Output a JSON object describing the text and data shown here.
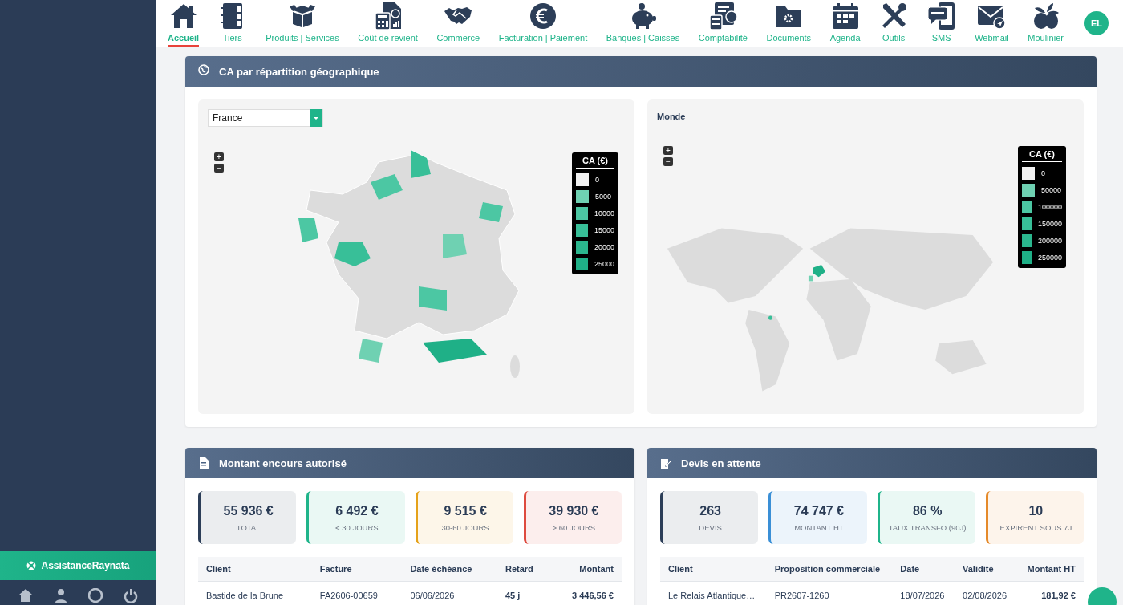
{
  "sidebar": {
    "support_button": "AssistanceRaynata"
  },
  "nav": {
    "items": [
      {
        "label": "Accueil",
        "selected": true
      },
      {
        "label": "Tiers",
        "selected": false
      },
      {
        "label": "Produits | Services",
        "selected": false
      },
      {
        "label": "Coût de revient",
        "selected": false
      },
      {
        "label": "Commerce",
        "selected": false
      },
      {
        "label": "Facturation | Paiement",
        "selected": false
      },
      {
        "label": "Banques | Caisses",
        "selected": false
      },
      {
        "label": "Comptabilité",
        "selected": false
      },
      {
        "label": "Documents",
        "selected": false
      },
      {
        "label": "Agenda",
        "selected": false
      },
      {
        "label": "Outils",
        "selected": false
      },
      {
        "label": "SMS",
        "selected": false
      },
      {
        "label": "Webmail",
        "selected": false
      },
      {
        "label": "Moulinier",
        "selected": false
      }
    ],
    "avatar": "EL"
  },
  "geo_panel": {
    "title": "CA par répartition géographique",
    "france": {
      "select_value": "France",
      "zoom_in": "+",
      "zoom_out": "−",
      "legend_title": "CA (€)",
      "legend": [
        {
          "label": "0",
          "color": "#f2f2f2"
        },
        {
          "label": "5000",
          "color": "#6fd1b2"
        },
        {
          "label": "10000",
          "color": "#4cc7a3"
        },
        {
          "label": "15000",
          "color": "#38bf98"
        },
        {
          "label": "20000",
          "color": "#2bb78e"
        },
        {
          "label": "25000",
          "color": "#1fb087"
        }
      ]
    },
    "world": {
      "title": "Monde",
      "zoom_in": "+",
      "zoom_out": "−",
      "legend_title": "CA (€)",
      "legend": [
        {
          "label": "0",
          "color": "#f2f2f2"
        },
        {
          "label": "50000",
          "color": "#6fd1b2"
        },
        {
          "label": "100000",
          "color": "#4cc7a3"
        },
        {
          "label": "150000",
          "color": "#38bf98"
        },
        {
          "label": "200000",
          "color": "#2bb78e"
        },
        {
          "label": "250000",
          "color": "#1fb087"
        }
      ]
    }
  },
  "encours_panel": {
    "title": "Montant encours autorisé",
    "stats": [
      {
        "value": "55 936 €",
        "label": "TOTAL",
        "color": "#2c3e58"
      },
      {
        "value": "6 492 €",
        "label": "< 30 JOURS",
        "color": "#1fb48a"
      },
      {
        "value": "9 515 €",
        "label": "30-60 JOURS",
        "color": "#e5a21a"
      },
      {
        "value": "39 930 €",
        "label": "> 60 JOURS",
        "color": "#de4b3f"
      }
    ],
    "columns": [
      "Client",
      "Facture",
      "Date échéance",
      "Retard",
      "Montant"
    ],
    "rows": [
      [
        "Bastide de la Brune",
        "FA2606-00659",
        "06/06/2026",
        "45 j",
        "3 446,56 €"
      ]
    ]
  },
  "devis_panel": {
    "title": "Devis en attente",
    "stats": [
      {
        "value": "263",
        "label": "DEVIS",
        "color": "#2c3e58"
      },
      {
        "value": "74 747 €",
        "label": "MONTANT HT",
        "color": "#3a8fd6"
      },
      {
        "value": "86 %",
        "label": "TAUX TRANSFO (90J)",
        "color": "#1fb48a"
      },
      {
        "value": "10",
        "label": "EXPIRENT SOUS 7J",
        "color": "#e58a2a"
      }
    ],
    "columns": [
      "Client",
      "Proposition commerciale",
      "Date",
      "Validité",
      "Montant HT"
    ],
    "rows": [
      [
        "Le Relais Atlantique…",
        "PR2607-1260",
        "18/07/2026",
        "02/08/2026",
        "181,92 €"
      ]
    ]
  }
}
